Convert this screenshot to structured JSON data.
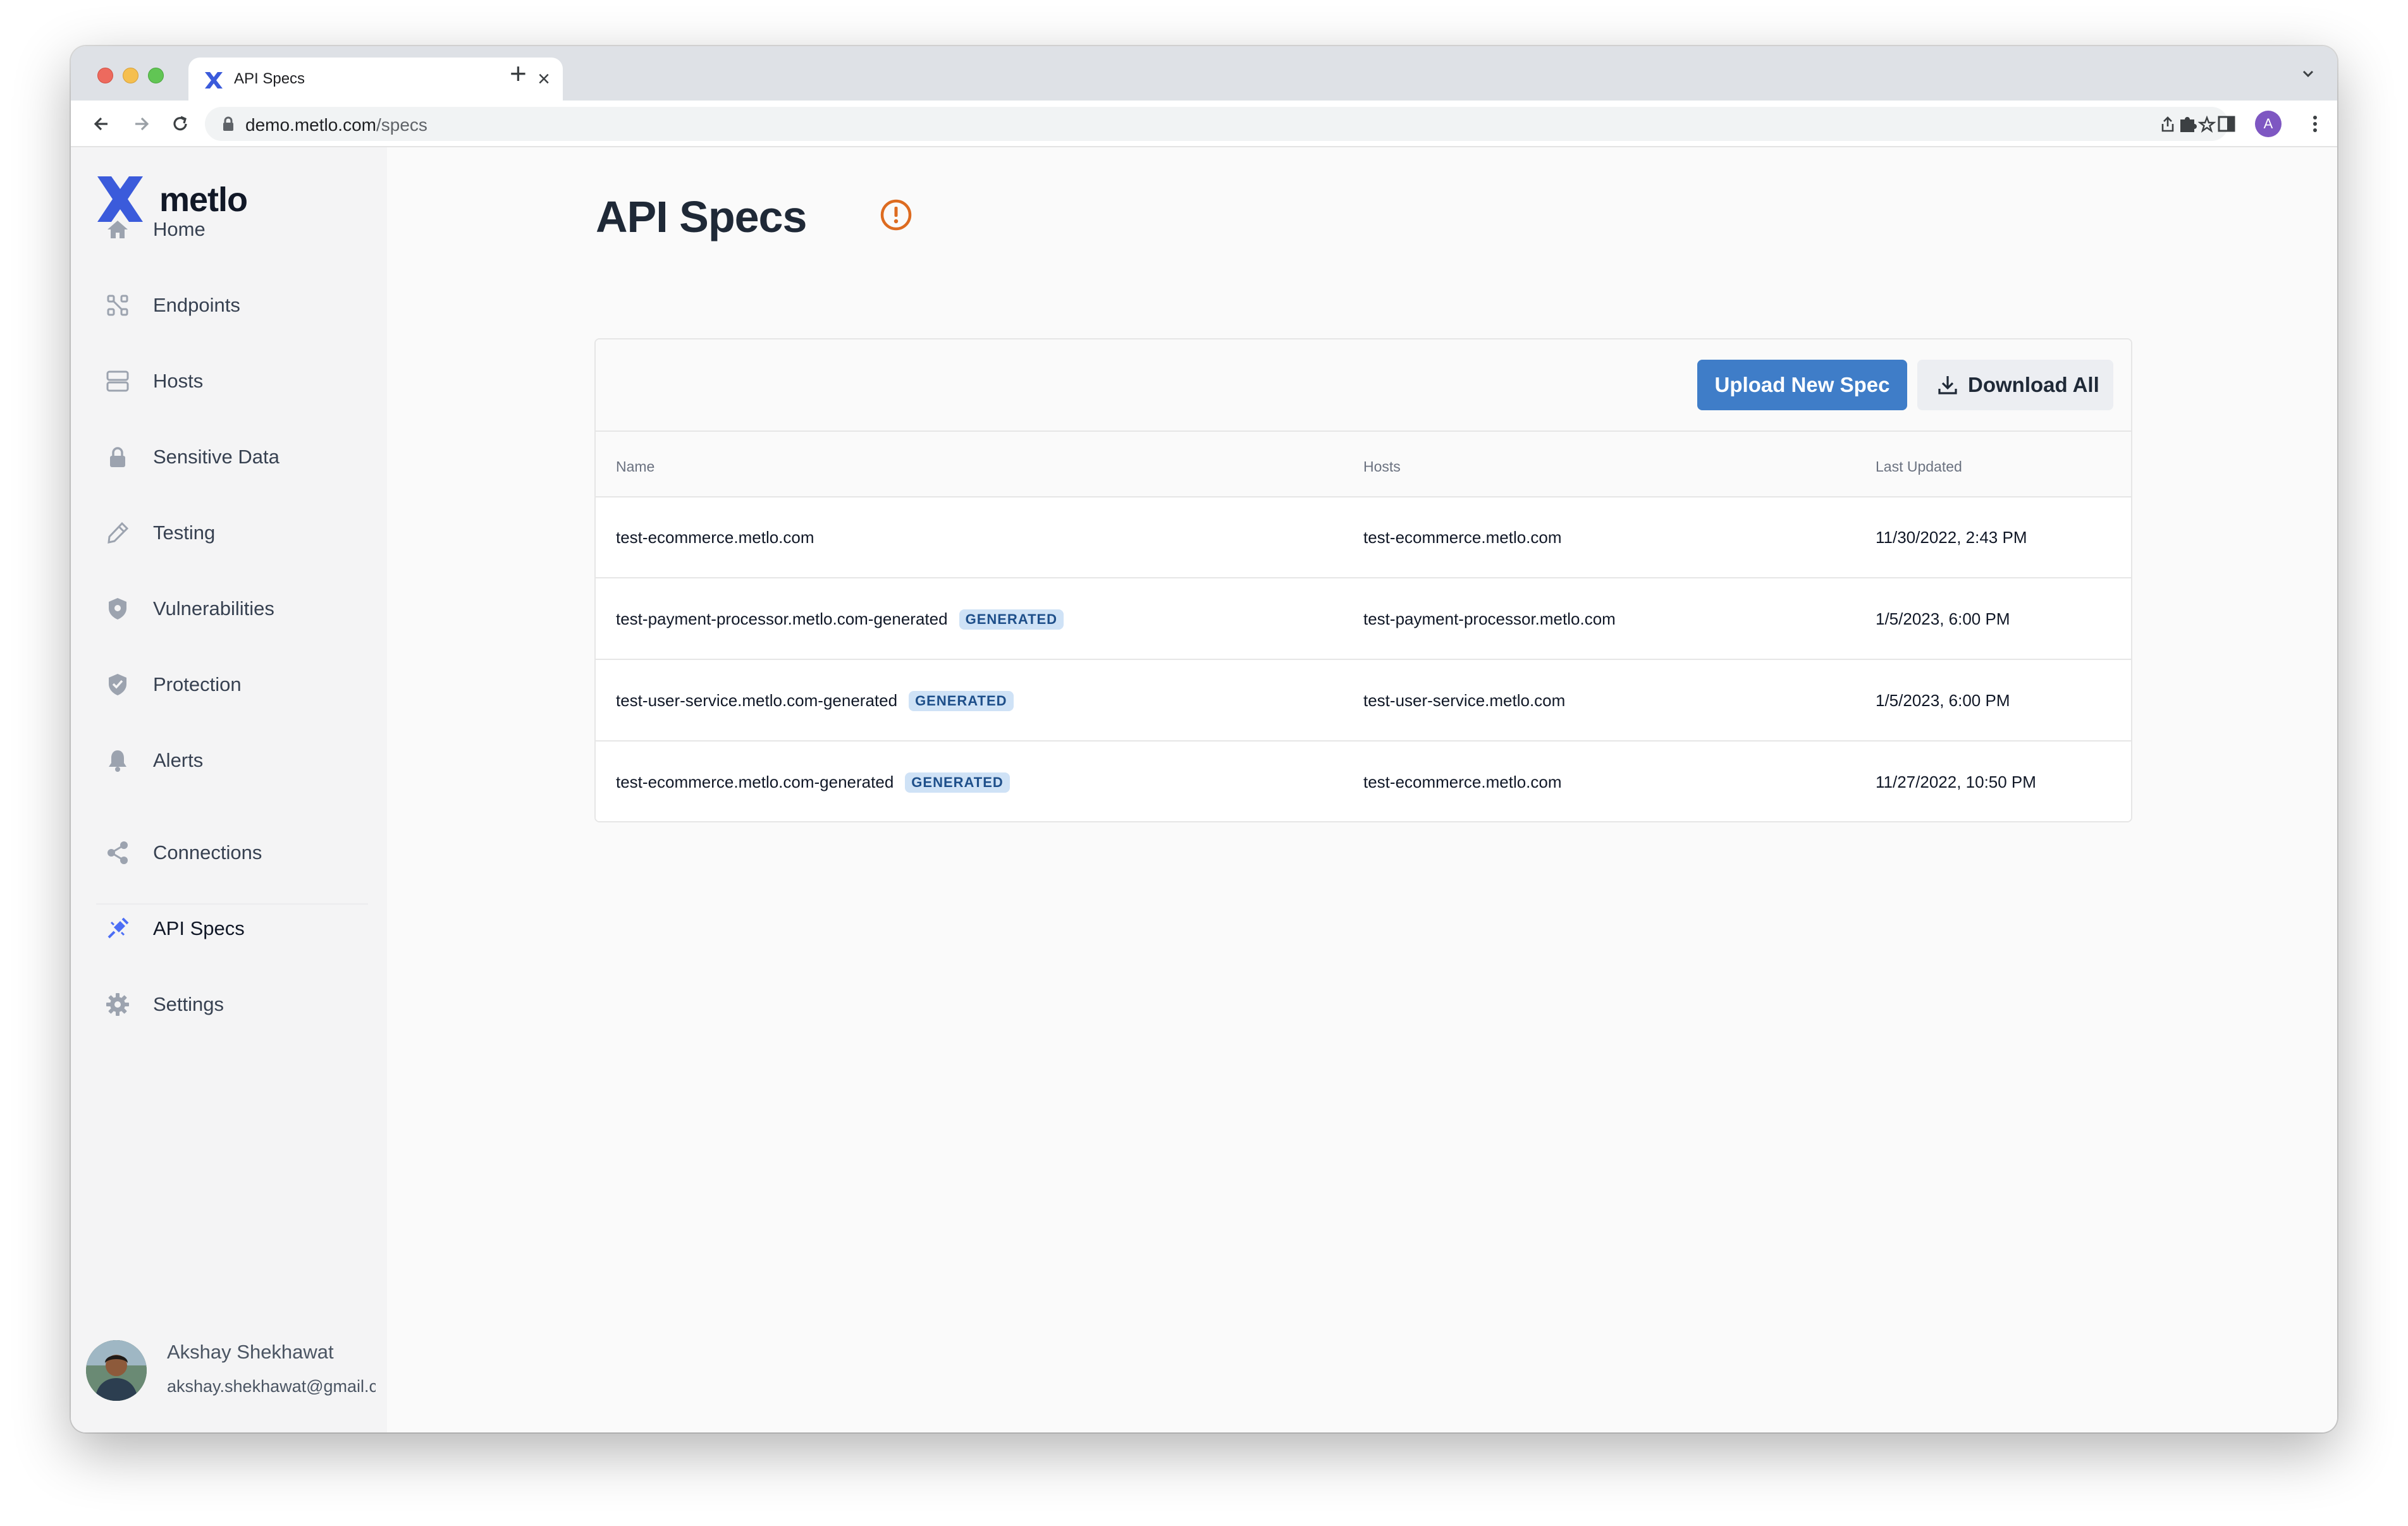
{
  "browser": {
    "tab_title": "API Specs",
    "tab_close": "×",
    "new_tab": "+",
    "url_host": "demo.metlo.com",
    "url_path": "/specs",
    "profile_initial": "A"
  },
  "sidebar": {
    "logo_text": "metlo",
    "items": [
      {
        "label": "Home",
        "icon": "home-icon"
      },
      {
        "label": "Endpoints",
        "icon": "endpoints-icon"
      },
      {
        "label": "Hosts",
        "icon": "server-icon"
      },
      {
        "label": "Sensitive Data",
        "icon": "lock-icon"
      },
      {
        "label": "Testing",
        "icon": "pen-icon"
      },
      {
        "label": "Vulnerabilities",
        "icon": "shield-bug-icon"
      },
      {
        "label": "Protection",
        "icon": "shield-check-icon"
      },
      {
        "label": "Alerts",
        "icon": "bell-icon"
      },
      {
        "label": "Connections",
        "icon": "share-icon"
      },
      {
        "label": "API Specs",
        "icon": "plug-icon",
        "active": true
      },
      {
        "label": "Settings",
        "icon": "gear-icon"
      }
    ],
    "user": {
      "name": "Akshay Shekhawat",
      "email": "akshay.shekhawat@gmail.com"
    }
  },
  "main": {
    "title": "API Specs",
    "upload_button": "Upload New Spec",
    "download_button": "Download All",
    "columns": [
      "Name",
      "Hosts",
      "Last Updated"
    ],
    "rows": [
      {
        "name": "test-ecommerce.metlo.com",
        "badge": "",
        "host": "test-ecommerce.metlo.com",
        "updated": "11/30/2022, 2:43 PM"
      },
      {
        "name": "test-payment-processor.metlo.com-generated",
        "badge": "GENERATED",
        "host": "test-payment-processor.metlo.com",
        "updated": "1/5/2023, 6:00 PM"
      },
      {
        "name": "test-user-service.metlo.com-generated",
        "badge": "GENERATED",
        "host": "test-user-service.metlo.com",
        "updated": "1/5/2023, 6:00 PM"
      },
      {
        "name": "test-ecommerce.metlo.com-generated",
        "badge": "GENERATED",
        "host": "test-ecommerce.metlo.com",
        "updated": "11/27/2022, 10:50 PM"
      }
    ]
  },
  "colors": {
    "brand": "#3b5bdb",
    "primary_button": "#3f7dc8",
    "warning": "#dd6b20",
    "badge_bg": "#cfe2f6",
    "badge_text": "#1e4f8a"
  }
}
